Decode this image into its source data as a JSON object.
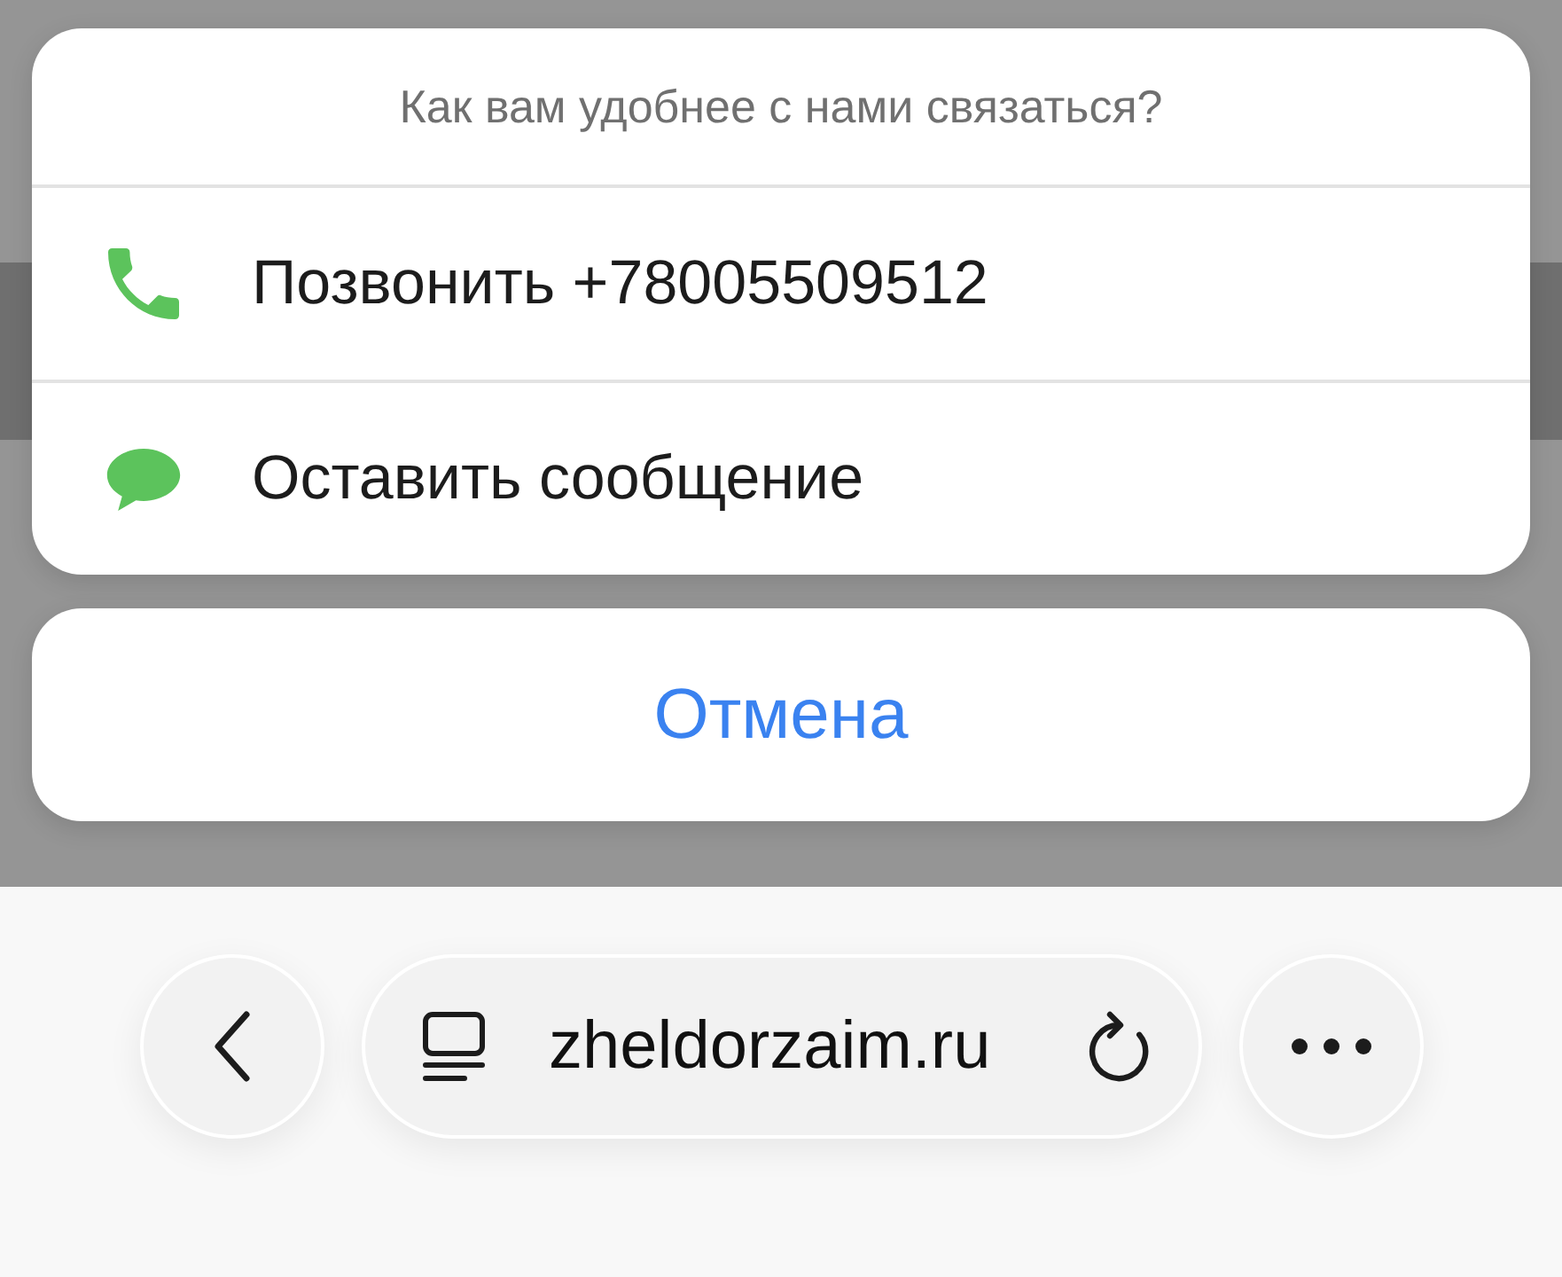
{
  "sheet": {
    "title": "Как вам удобнее с нами связаться?",
    "actions": [
      {
        "kind": "call",
        "label": "Позвонить +78005509512"
      },
      {
        "kind": "message",
        "label": "Оставить сообщение"
      }
    ]
  },
  "cancel_button": "Отмена",
  "browser_toolbar": {
    "url": "zheldorzaim.ru"
  }
}
